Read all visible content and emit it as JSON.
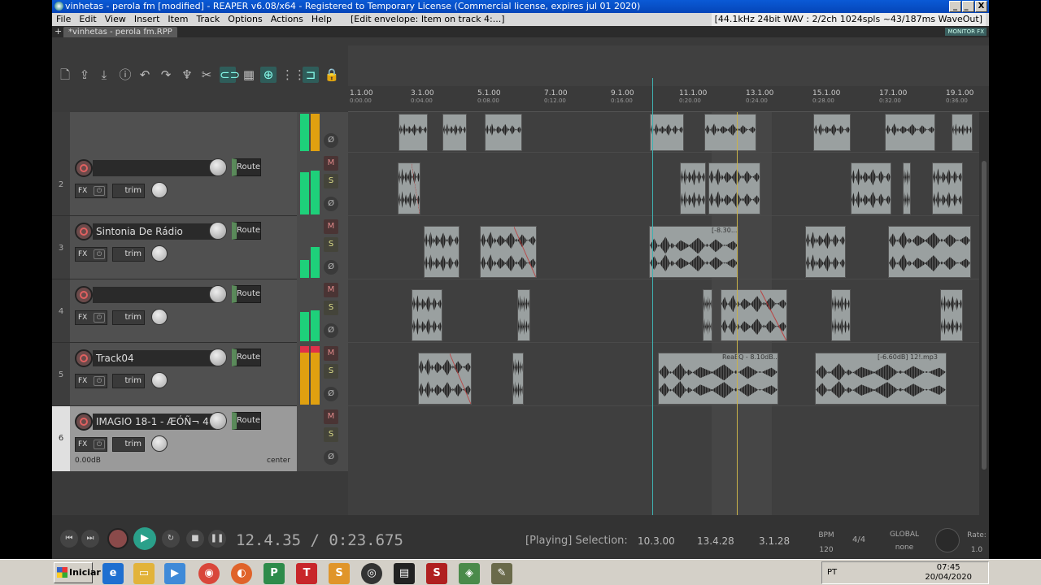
{
  "window": {
    "title": "vinhetas - perola fm [modified] - REAPER v6.08/x64 - Registered to Temporary License (Commercial license, expires jul 01 2020)",
    "buttons": [
      "_",
      "̲",
      "X"
    ]
  },
  "menu": {
    "items": [
      "File",
      "Edit",
      "View",
      "Insert",
      "Item",
      "Track",
      "Options",
      "Actions",
      "Help"
    ],
    "hint": "[Edit envelope: Item on track 4:...]",
    "status": "[44.1kHz 24bit WAV : 2/2ch 1024spls ~43/187ms WaveOut]"
  },
  "tab": {
    "plus": "+",
    "label": "*vinhetas - perola fm.RPP",
    "monitor": "MONITOR FX"
  },
  "toolbar": {
    "icons": [
      "new-project-icon",
      "open-icon",
      "save-icon",
      "info-icon",
      "undo-icon",
      "redo-icon",
      "metronome-icon",
      "trim-icon",
      "link-icon",
      "grid-icon",
      "ripple-icon",
      "grid2-icon",
      "snap-icon",
      "lock-icon"
    ]
  },
  "tracks": [
    {
      "num": "",
      "name": "",
      "route": "Route"
    },
    {
      "num": "2",
      "name": "",
      "route": "Route",
      "fx": "FX",
      "trim": "trim"
    },
    {
      "num": "3",
      "name": "Sintonia De Rádio",
      "route": "Route",
      "fx": "FX",
      "trim": "trim"
    },
    {
      "num": "4",
      "name": "",
      "route": "Route",
      "fx": "FX",
      "trim": "trim"
    },
    {
      "num": "5",
      "name": "Track04",
      "route": "Route",
      "fx": "FX",
      "trim": "trim"
    },
    {
      "num": "6",
      "name": "IMAGIO 18-1 - ÆÓÑ¬ 44",
      "route": "Route",
      "fx": "FX",
      "trim": "trim",
      "vol": "0.00dB",
      "pan": "center"
    }
  ],
  "msb": {
    "m": "M",
    "s": "S",
    "p": "Ø"
  },
  "ruler": [
    {
      "bar": "1.1.00",
      "time": "0:00.00"
    },
    {
      "bar": "3.1.00",
      "time": "0:04.00"
    },
    {
      "bar": "5.1.00",
      "time": "0:08.00"
    },
    {
      "bar": "7.1.00",
      "time": "0:12.00"
    },
    {
      "bar": "9.1.00",
      "time": "0:16.00"
    },
    {
      "bar": "11.1.00",
      "time": "0:20.00"
    },
    {
      "bar": "13.1.00",
      "time": "0:24.00"
    },
    {
      "bar": "15.1.00",
      "time": "0:28.00"
    },
    {
      "bar": "17.1.00",
      "time": "0:32.00"
    },
    {
      "bar": "19.1.00",
      "time": "0:36.00"
    }
  ],
  "item_labels": {
    "t3": "[-8.30...",
    "t5a": "ReaEQ - 8.10dB...",
    "t5b": "[-6.60dB] 12!.mp3"
  },
  "transport": {
    "time": "12.4.35 / 0:23.675",
    "state": "[Playing] Selection:",
    "sel_start": "10.3.00",
    "sel_end": "13.4.28",
    "sel_len": "3.1.28",
    "bpm_label": "BPM",
    "bpm": "120",
    "timesig": "4/4",
    "global_label": "GLOBAL",
    "global_val": "none",
    "rate_label": "Rate:",
    "rate": "1.0"
  },
  "taskbar": {
    "start": "Iniciar",
    "lang": "PT",
    "time": "07:45",
    "date": "20/04/2020",
    "apps": [
      "ie",
      "explorer",
      "media",
      "chrome",
      "firefox",
      "publisher",
      "t-app",
      "s-app",
      "obs",
      "film",
      "sonic",
      "reaper",
      "gimp"
    ]
  },
  "colors": {
    "accent": "#2aa08a",
    "meter": "#1ed07a",
    "meter_warn": "#e0a010",
    "rec": "#e06060"
  }
}
